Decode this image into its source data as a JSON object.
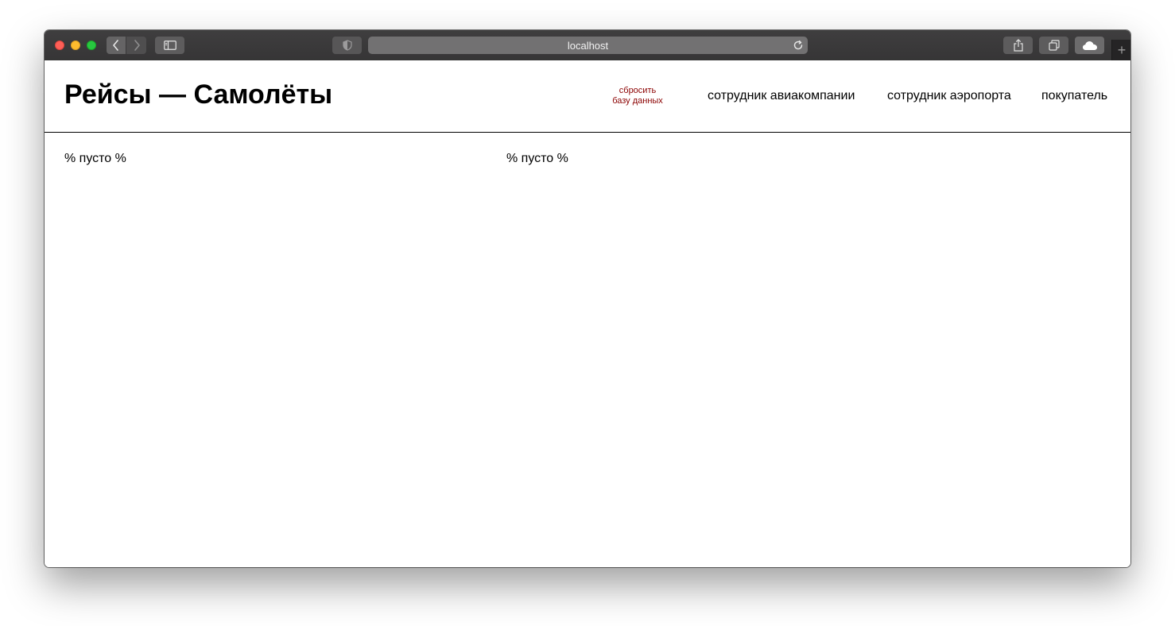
{
  "browser": {
    "url": "localhost",
    "icons": {
      "back": "chevron-left-icon",
      "forward": "chevron-right-icon",
      "sidebar": "sidebar-icon",
      "privacy": "shield-icon",
      "reload": "reload-icon",
      "share": "share-icon",
      "tabs": "tabs-overview-icon",
      "cloud": "cloud-icon",
      "new_tab": "plus-icon"
    },
    "new_tab_label": "+"
  },
  "header": {
    "title": "Рейсы — Самолёты",
    "reset": {
      "line1": "сбросить",
      "line2": "базу данных",
      "color": "#8b0000"
    },
    "nav": [
      {
        "label": "сотрудник авиакомпании"
      },
      {
        "label": "сотрудник аэропорта"
      },
      {
        "label": "покупатель"
      }
    ]
  },
  "main": {
    "flights_empty": "% пусто %",
    "planes_empty": "% пусто %"
  }
}
